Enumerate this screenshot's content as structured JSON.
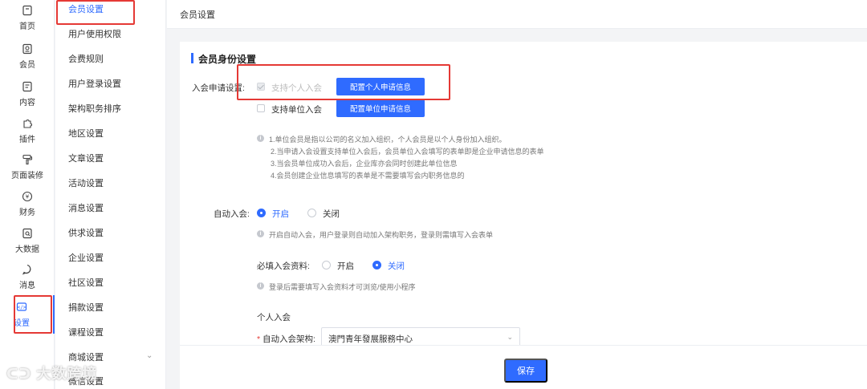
{
  "rail": {
    "items": [
      {
        "label": "首页",
        "icon": "home-icon"
      },
      {
        "label": "会员",
        "icon": "member-icon"
      },
      {
        "label": "内容",
        "icon": "content-icon"
      },
      {
        "label": "插件",
        "icon": "plugin-icon"
      },
      {
        "label": "页面装修",
        "icon": "brush-icon"
      },
      {
        "label": "财务",
        "icon": "yen-icon"
      },
      {
        "label": "大数据",
        "icon": "data-icon"
      },
      {
        "label": "消息",
        "icon": "message-icon"
      },
      {
        "label": "设置",
        "icon": "settings-icon"
      }
    ]
  },
  "submenu": {
    "items": [
      "会员设置",
      "用户使用权限",
      "会费规则",
      "用户登录设置",
      "架构职务排序",
      "地区设置",
      "文章设置",
      "活动设置",
      "消息设置",
      "供求设置",
      "企业设置",
      "社区设置",
      "捐款设置",
      "课程设置",
      "商城设置",
      "微信设置"
    ]
  },
  "topbar": {
    "title": "会员设置"
  },
  "main": {
    "section_title": "会员身份设置",
    "apply_label": "入会申请设置:",
    "personal_checkbox": "支持个人入会",
    "personal_btn": "配置个人申请信息",
    "unit_checkbox": "支持单位入会",
    "unit_btn": "配置单位申请信息",
    "notes": [
      "1.单位会员是指以公司的名义加入组织，个人会员是以个人身份加入组织。",
      "2.当申请入会设置支持单位入会后，会员单位入会填写的表单即是企业申请信息的表单",
      "3.当会员单位成功入会后，企业库亦会同时创建此单位信息",
      "4.会员创建企业信息填写的表单是不需要填写会内职务信息的"
    ],
    "auto_join_label": "自动入会:",
    "auto_on": "开启",
    "auto_off": "关闭",
    "auto_note": "开启自动入会，用户登录则自动加入架构职务，登录则需填写入会表单",
    "required_label": "必填入会资料:",
    "required_on": "开启",
    "required_off": "关闭",
    "required_note": "登录后需要填写入会资料才可浏览/使用小程序",
    "personal_section": "个人入会",
    "org_label": "自动入会架构:",
    "org_value": "澳門青年發展服務中心",
    "required_mark": "*"
  },
  "footer": {
    "save": "保存"
  },
  "watermark": "大数跨境"
}
